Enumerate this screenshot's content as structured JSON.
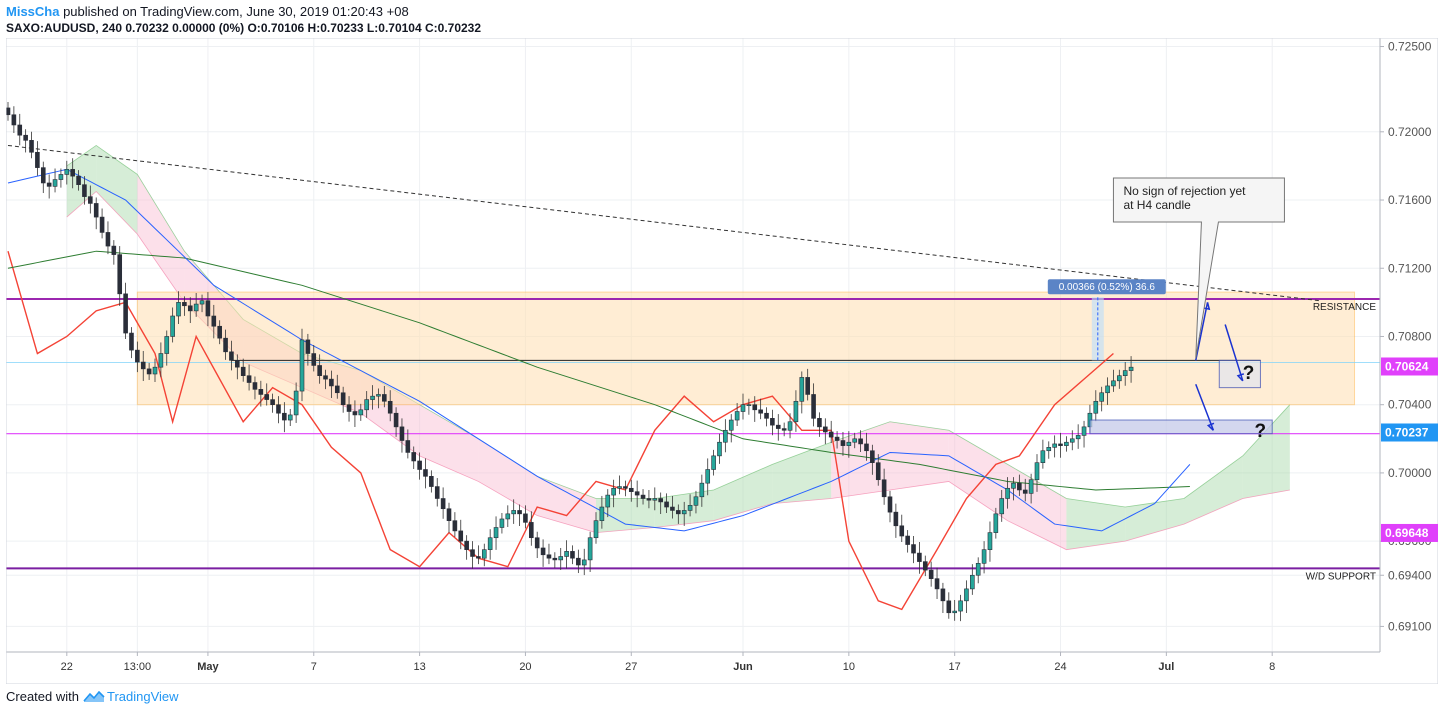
{
  "header": {
    "author": "MissCha",
    "published": " published on TradingView.com, June 30, 2019 01:20:43 +08",
    "symbol": "SAXO:AUDUSD, 240",
    "quote": " 0.70232 0.00000 (0%) ",
    "o_label": "O:",
    "o_val": "0.70106",
    "h_label": " H:",
    "h_val": "0.70233",
    "l_label": " L:",
    "l_val": "0.70104",
    "c_label": " C:",
    "c_val": "0.70232"
  },
  "footer": {
    "created_with": "Created with",
    "brand": "TradingView"
  },
  "colors": {
    "bull": "#26a69a",
    "bear": "#ef5350",
    "sma_blue": "#2962ff",
    "sma_green": "#2e7d32",
    "lagging": "#f44336",
    "level_line": "#9c27b0",
    "support_line": "#7b1fa2",
    "box_fill": "#ffe0b2",
    "cloud_green": "#a5d6a7",
    "cloud_red": "#f8bbd0",
    "price_tag": "#e040fb",
    "price_tag_blue": "#2196f3"
  },
  "chart_data": {
    "type": "candlestick",
    "y_axis": {
      "min": 0.6895,
      "max": 0.7255,
      "ticks": [
        "0.72500",
        "0.72000",
        "0.71600",
        "0.71200",
        "0.70800",
        "0.70400",
        "0.70000",
        "0.69600",
        "0.69400",
        "0.69100"
      ],
      "tick_values": [
        0.725,
        0.72,
        0.716,
        0.712,
        0.708,
        0.704,
        0.7,
        0.696,
        0.694,
        0.691
      ]
    },
    "x_axis": {
      "labels": [
        "22",
        "13:00",
        "May",
        "7",
        "13",
        "20",
        "27",
        "Jun",
        "10",
        "17",
        "24",
        "Jul",
        "8"
      ],
      "bold_labels": [
        "May",
        "Jun",
        "Jul"
      ],
      "label_bars": [
        10,
        22,
        34,
        52,
        70,
        88,
        106,
        125,
        143,
        161,
        179,
        197,
        215
      ]
    },
    "price_labels": [
      {
        "text": "0.70624",
        "value": 0.70624,
        "color": "#e040fb"
      },
      {
        "text": "0.70237",
        "value": 0.70237,
        "color": "#2196f3"
      },
      {
        "text": "0.69648",
        "value": 0.69648,
        "color": "#e040fb"
      }
    ],
    "closes": [
      0.721,
      0.7204,
      0.7198,
      0.7195,
      0.7188,
      0.7179,
      0.717,
      0.7168,
      0.7172,
      0.7175,
      0.7178,
      0.7174,
      0.7169,
      0.7162,
      0.7158,
      0.715,
      0.7141,
      0.7133,
      0.7128,
      0.7105,
      0.7082,
      0.7072,
      0.7065,
      0.7061,
      0.7058,
      0.7062,
      0.707,
      0.708,
      0.7092,
      0.71,
      0.7098,
      0.7095,
      0.7099,
      0.7101,
      0.7092,
      0.7086,
      0.7079,
      0.7071,
      0.7066,
      0.7062,
      0.7057,
      0.7053,
      0.7049,
      0.7046,
      0.7043,
      0.704,
      0.7035,
      0.7031,
      0.7034,
      0.7048,
      0.7078,
      0.707,
      0.7063,
      0.7057,
      0.7055,
      0.7051,
      0.7047,
      0.704,
      0.7036,
      0.7034,
      0.7037,
      0.7043,
      0.7045,
      0.7046,
      0.7042,
      0.7035,
      0.7027,
      0.7019,
      0.7012,
      0.7007,
      0.7002,
      0.6998,
      0.6992,
      0.6985,
      0.6979,
      0.6972,
      0.6966,
      0.696,
      0.6955,
      0.6951,
      0.695,
      0.6955,
      0.6962,
      0.6968,
      0.6973,
      0.6976,
      0.6978,
      0.6976,
      0.6971,
      0.6962,
      0.6956,
      0.6952,
      0.695,
      0.6949,
      0.6951,
      0.6954,
      0.695,
      0.6946,
      0.6949,
      0.6962,
      0.6972,
      0.698,
      0.6987,
      0.6991,
      0.6992,
      0.6991,
      0.6989,
      0.6987,
      0.6985,
      0.6984,
      0.6985,
      0.6983,
      0.698,
      0.6978,
      0.6976,
      0.6978,
      0.6981,
      0.6986,
      0.6994,
      0.7002,
      0.701,
      0.7018,
      0.7025,
      0.7031,
      0.7036,
      0.704,
      0.704,
      0.7037,
      0.7035,
      0.7032,
      0.7028,
      0.7026,
      0.7025,
      0.703,
      0.7042,
      0.7056,
      0.7046,
      0.7032,
      0.7027,
      0.7024,
      0.7021,
      0.7019,
      0.7016,
      0.7018,
      0.702,
      0.7017,
      0.7013,
      0.7006,
      0.6996,
      0.6986,
      0.6977,
      0.6969,
      0.6963,
      0.6958,
      0.6953,
      0.6948,
      0.6943,
      0.6938,
      0.6932,
      0.6925,
      0.6918,
      0.6919,
      0.6925,
      0.6932,
      0.694,
      0.6947,
      0.6955,
      0.6965,
      0.6976,
      0.6985,
      0.6991,
      0.6994,
      0.699,
      0.6988,
      0.6996,
      0.7006,
      0.7013,
      0.7015,
      0.7017,
      0.7016,
      0.7018,
      0.702,
      0.7022,
      0.7027,
      0.7035,
      0.7042,
      0.7047,
      0.7051,
      0.7054,
      0.7057,
      0.706,
      0.7062
    ],
    "sma_blue_key": [
      [
        0,
        0.717
      ],
      [
        10,
        0.7178
      ],
      [
        20,
        0.716
      ],
      [
        35,
        0.711
      ],
      [
        50,
        0.7078
      ],
      [
        70,
        0.7042
      ],
      [
        90,
        0.6998
      ],
      [
        105,
        0.697
      ],
      [
        115,
        0.6966
      ],
      [
        125,
        0.6975
      ],
      [
        140,
        0.6995
      ],
      [
        150,
        0.7012
      ],
      [
        160,
        0.701
      ],
      [
        170,
        0.699
      ],
      [
        178,
        0.697
      ],
      [
        186,
        0.6966
      ],
      [
        195,
        0.6982
      ],
      [
        201,
        0.7005
      ]
    ],
    "sma_green_key": [
      [
        0,
        0.712
      ],
      [
        15,
        0.713
      ],
      [
        30,
        0.7126
      ],
      [
        50,
        0.711
      ],
      [
        70,
        0.7088
      ],
      [
        90,
        0.7062
      ],
      [
        110,
        0.704
      ],
      [
        125,
        0.702
      ],
      [
        140,
        0.7012
      ],
      [
        155,
        0.7005
      ],
      [
        170,
        0.6995
      ],
      [
        185,
        0.699
      ],
      [
        201,
        0.6992
      ]
    ],
    "lagging_key": [
      [
        0,
        0.713
      ],
      [
        5,
        0.707
      ],
      [
        10,
        0.708
      ],
      [
        15,
        0.7095
      ],
      [
        20,
        0.71
      ],
      [
        25,
        0.707
      ],
      [
        28,
        0.703
      ],
      [
        32,
        0.708
      ],
      [
        36,
        0.7055
      ],
      [
        40,
        0.703
      ],
      [
        45,
        0.705
      ],
      [
        50,
        0.704
      ],
      [
        55,
        0.7015
      ],
      [
        60,
        0.7
      ],
      [
        65,
        0.6955
      ],
      [
        70,
        0.6945
      ],
      [
        75,
        0.6965
      ],
      [
        80,
        0.695
      ],
      [
        85,
        0.6945
      ],
      [
        90,
        0.698
      ],
      [
        95,
        0.6975
      ],
      [
        100,
        0.6995
      ],
      [
        105,
        0.699
      ],
      [
        110,
        0.7025
      ],
      [
        115,
        0.7045
      ],
      [
        120,
        0.703
      ],
      [
        125,
        0.704
      ],
      [
        130,
        0.7045
      ],
      [
        135,
        0.7025
      ],
      [
        140,
        0.7025
      ],
      [
        143,
        0.696
      ],
      [
        148,
        0.6925
      ],
      [
        152,
        0.692
      ],
      [
        158,
        0.6955
      ],
      [
        163,
        0.6985
      ],
      [
        168,
        0.7005
      ],
      [
        172,
        0.701
      ],
      [
        178,
        0.704
      ],
      [
        183,
        0.7055
      ],
      [
        188,
        0.707
      ]
    ],
    "cloud_key": [
      [
        10,
        0.718,
        0.715
      ],
      [
        15,
        0.7192,
        0.7165
      ],
      [
        22,
        0.7175,
        0.714
      ],
      [
        30,
        0.713,
        0.71
      ],
      [
        40,
        0.709,
        0.7065
      ],
      [
        50,
        0.707,
        0.705
      ],
      [
        60,
        0.706,
        0.7035
      ],
      [
        70,
        0.704,
        0.701
      ],
      [
        80,
        0.702,
        0.6995
      ],
      [
        90,
        0.6998,
        0.6975
      ],
      [
        100,
        0.6985,
        0.6965
      ],
      [
        110,
        0.6985,
        0.6968
      ],
      [
        120,
        0.699,
        0.6972
      ],
      [
        130,
        0.7005,
        0.6982
      ],
      [
        140,
        0.7018,
        0.6985
      ],
      [
        150,
        0.703,
        0.699
      ],
      [
        160,
        0.7025,
        0.6995
      ],
      [
        170,
        0.7005,
        0.6972
      ],
      [
        180,
        0.6985,
        0.6955
      ],
      [
        190,
        0.698,
        0.696
      ],
      [
        200,
        0.6985,
        0.697
      ],
      [
        210,
        0.701,
        0.6985
      ],
      [
        218,
        0.704,
        0.699
      ]
    ],
    "levels": {
      "resistance": {
        "label": "RESISTANCE",
        "value": 0.7102
      },
      "support": {
        "label": "W/D SUPPORT",
        "value": 0.6944
      },
      "pink": {
        "value": 0.7023
      },
      "box_top": 0.7106,
      "box_bottom": 0.704,
      "black_line": 0.7066
    },
    "trendline": {
      "start": [
        0,
        0.7192
      ],
      "end": [
        223,
        0.7101
      ]
    },
    "measure": {
      "text": "0.00366 (0.52%) 36.6",
      "from": 0.7066,
      "to": 0.7103,
      "bar": 185
    },
    "callout": {
      "line1": "No sign of rejection yet",
      "line2": "at H4 candle"
    },
    "question_marks": [
      "?",
      "?"
    ],
    "targets": [
      {
        "bar_from": 206,
        "bar_to": 213,
        "top": 0.7066,
        "bottom": 0.705
      },
      {
        "bar_from": 184,
        "bar_to": 215,
        "top": 0.7031,
        "bottom": 0.7023
      }
    ]
  }
}
